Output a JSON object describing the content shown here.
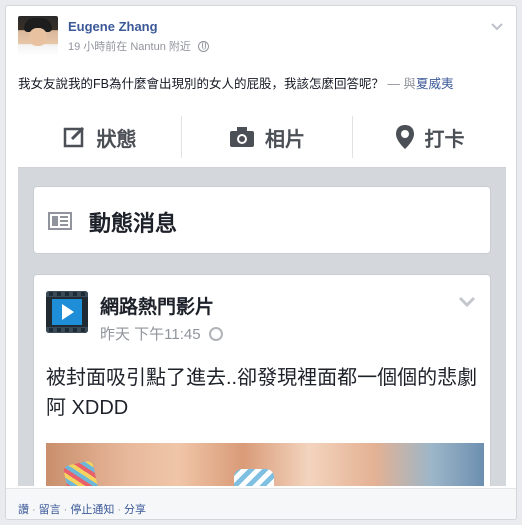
{
  "post": {
    "author": "Eugene Zhang",
    "time": "19 小時前在",
    "location": "Nantun",
    "location_suffix": "附近",
    "privacy_icon": "globe-icon",
    "text": "我女友說我的FB為什麼會出現別的女人的屁股，我該怎麼回答呢？",
    "dash": " — 與",
    "tagged": "夏威夷"
  },
  "screenshot": {
    "composer": {
      "status_label": "狀態",
      "photo_label": "相片",
      "checkin_label": "打卡"
    },
    "feed_title": "動態消息",
    "video_post": {
      "page_name": "網路熱門影片",
      "time": "昨天 下午11:45",
      "text": "被封面吸引點了進去..卻發現裡面都一個個的悲劇阿 XDDD"
    }
  },
  "actions": {
    "like": "讚",
    "comment": "留言",
    "stop_notify": "停止通知",
    "share": "分享",
    "sep": "·"
  },
  "colors": {
    "link": "#3b5998",
    "meta": "#90949c",
    "background": "#e9ebee"
  }
}
